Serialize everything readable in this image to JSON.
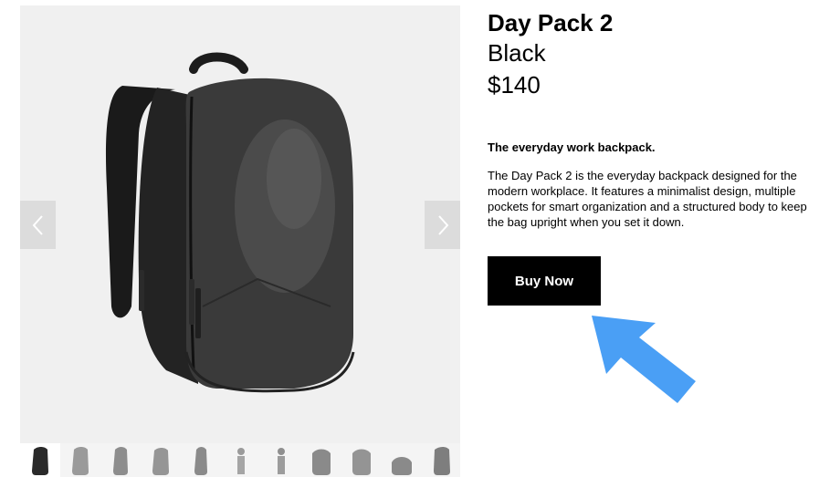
{
  "product": {
    "title": "Day Pack 2",
    "color": "Black",
    "price": "$140",
    "tagline": "The everyday work backpack.",
    "description": "The Day Pack 2 is the everyday backpack designed for the modern workplace. It features a minimalist design, multiple pockets for smart organization and a structured body to keep the bag upright when you set it down."
  },
  "actions": {
    "buy_label": "Buy Now"
  },
  "gallery": {
    "prev_icon": "chevron-left-icon",
    "next_icon": "chevron-right-icon",
    "thumbnail_count": 11,
    "active_thumbnail": 1
  },
  "colors": {
    "button_bg": "#000000",
    "button_text": "#ffffff",
    "annotation_arrow": "#4a9ff5",
    "gallery_bg": "#f0f0f0"
  }
}
